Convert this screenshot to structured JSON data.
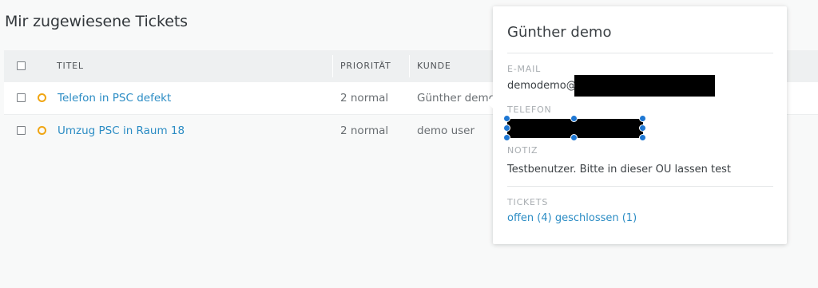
{
  "page": {
    "title": "Mir zugewiesene Tickets"
  },
  "table": {
    "columns": {
      "title": "TITEL",
      "priority": "PRIORITÄT",
      "customer": "KUNDE"
    },
    "rows": [
      {
        "title": "Telefon in PSC defekt",
        "priority": "2 normal",
        "customer": "Günther demo"
      },
      {
        "title": "Umzug PSC in Raum 18",
        "priority": "2 normal",
        "customer": "demo user"
      }
    ]
  },
  "popover": {
    "name": "Günther demo",
    "email_label": "E-MAIL",
    "email_value": "demodemo@",
    "phone_label": "TELEFON",
    "note_label": "NOTIZ",
    "note_value": "Testbenutzer. Bitte in dieser OU lassen test",
    "tickets_label": "TICKETS",
    "tickets_open": "offen (4)",
    "tickets_closed": "geschlossen (1)"
  },
  "colors": {
    "accent": "#2b8cc4",
    "priority_normal": "#f0a512",
    "selection_handle": "#1e77d3"
  }
}
